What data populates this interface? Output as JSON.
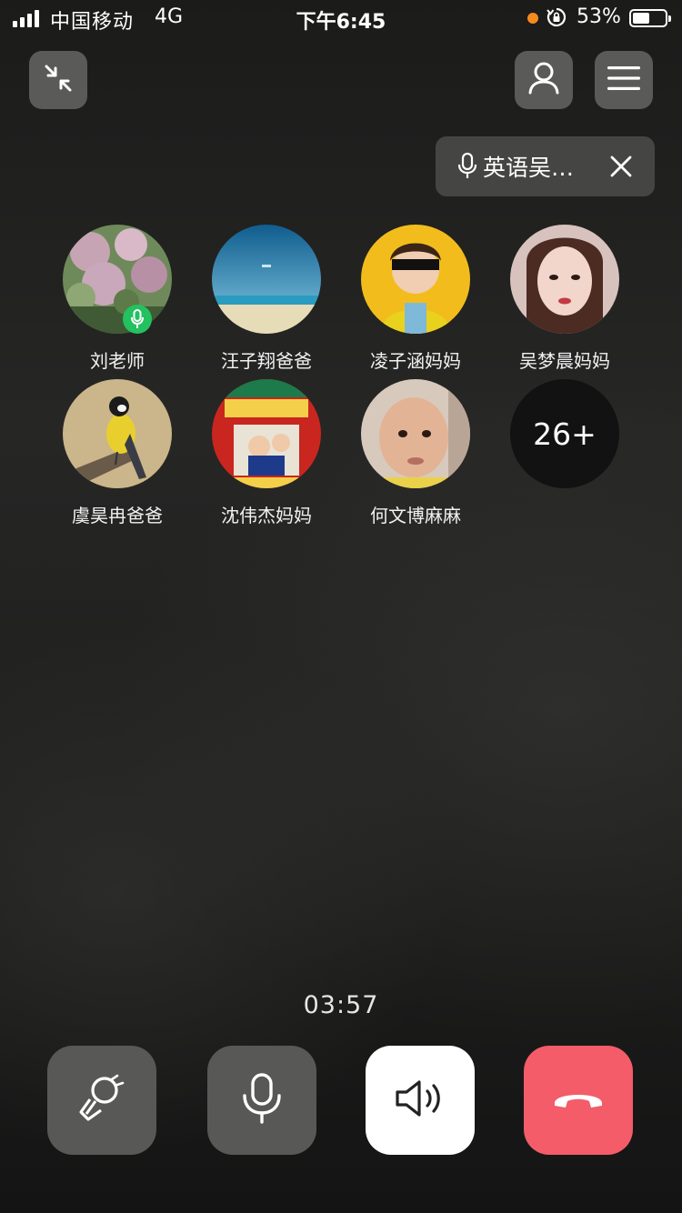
{
  "status_bar": {
    "carrier": "中国移动",
    "network": "4G",
    "time": "下午6:45",
    "battery_percent": "53%",
    "battery_level": 0.53,
    "icons": [
      "signal-icon",
      "orange-dot-indicator",
      "rotation-lock-icon",
      "battery-icon"
    ]
  },
  "top_bar": {
    "minimize_icon": "minimize-arrows-icon",
    "person_icon": "person-icon",
    "menu_icon": "hamburger-menu-icon"
  },
  "speaking_pill": {
    "icon": "microphone-icon",
    "name": "英语吴…",
    "close_icon": "close-icon"
  },
  "participants": [
    {
      "name": "刘老师",
      "speaking": true
    },
    {
      "name": "汪子翔爸爸"
    },
    {
      "name": "凌子涵妈妈"
    },
    {
      "name": "吴梦晨妈妈"
    },
    {
      "name": "虞昊冉爸爸"
    },
    {
      "name": "沈伟杰妈妈"
    },
    {
      "name": "何文博麻麻"
    }
  ],
  "more_participants": "26+",
  "timer": "03:57",
  "controls": {
    "effect_icon": "magic-wand-icon",
    "mic_icon": "microphone-icon",
    "speaker_icon": "speaker-icon",
    "hangup_icon": "hang-up-icon"
  },
  "colors": {
    "speaking_badge": "#23c160",
    "hangup": "#f45c69",
    "control_bg": "#585957",
    "status_dot": "#f58a1f"
  }
}
